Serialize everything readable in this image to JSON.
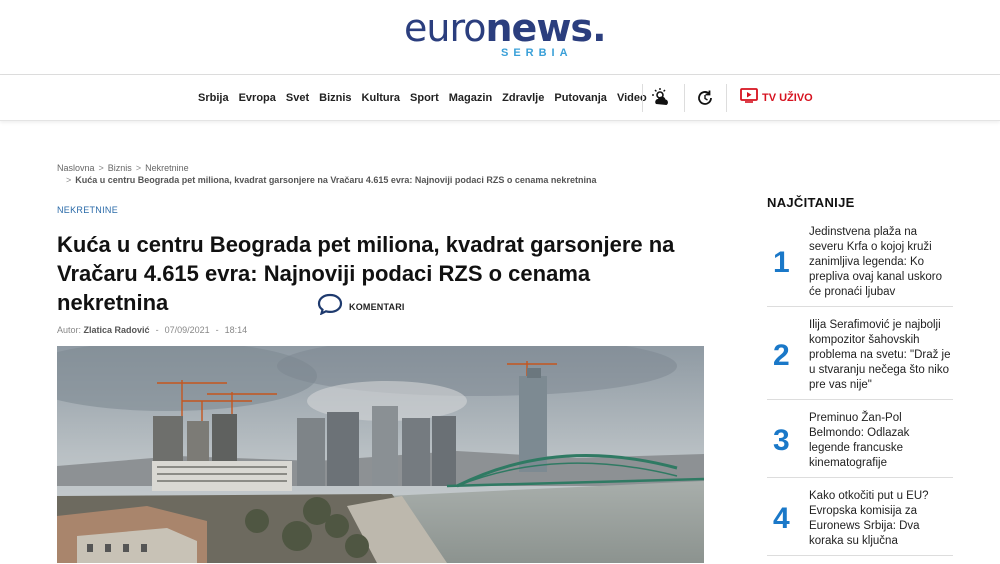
{
  "logo": {
    "part1": "euro",
    "part2": "news",
    "dot": ".",
    "sub": "SERBIA"
  },
  "nav": {
    "items": [
      "Srbija",
      "Evropa",
      "Svet",
      "Biznis",
      "Kultura",
      "Sport",
      "Magazin",
      "Zdravlje",
      "Putovanja",
      "Video"
    ],
    "tv_label": "TV UŽIVO"
  },
  "breadcrumb": {
    "items": [
      "Naslovna",
      "Biznis",
      "Nekretnine"
    ],
    "current": "Kuća u centru Beograda pet miliona, kvadrat garsonjere na Vračaru 4.615 evra: Najnoviji podaci RZS o cenama nekretnina"
  },
  "article": {
    "category": "NEKRETNINE",
    "title": "Kuća u centru Beograda pet miliona, kvadrat garsonjere na Vračaru 4.615 evra: Najnoviji podaci RZS o cenama nekretnina",
    "comments_label": "KOMENTARI",
    "author_prefix": "Autor:",
    "author": "Zlatica Radović",
    "date": "07/09/2021",
    "time": "18:14"
  },
  "sidebar": {
    "title": "NAJČITANIJE",
    "items": [
      {
        "num": "1",
        "text": "Jedinstvena plaža na severu Krfa o kojoj kruži zanimljiva legenda: Ko prepliva ovaj kanal uskoro će pronaći ljubav"
      },
      {
        "num": "2",
        "text": "Ilija Serafimović je najbolji kompozitor šahovskih problema na svetu: \"Draž je u stvaranju nečega što niko pre vas nije\""
      },
      {
        "num": "3",
        "text": "Preminuo Žan-Pol Belmondo: Odlazak legende francuske kinematografije"
      },
      {
        "num": "4",
        "text": "Kako otkočiti put u EU? Evropska komisija za Euronews Srbija: Dva koraka su ključna"
      }
    ]
  },
  "colors": {
    "brand": "#2b3e7e",
    "accent": "#1a78c8",
    "live": "#d6121f"
  }
}
